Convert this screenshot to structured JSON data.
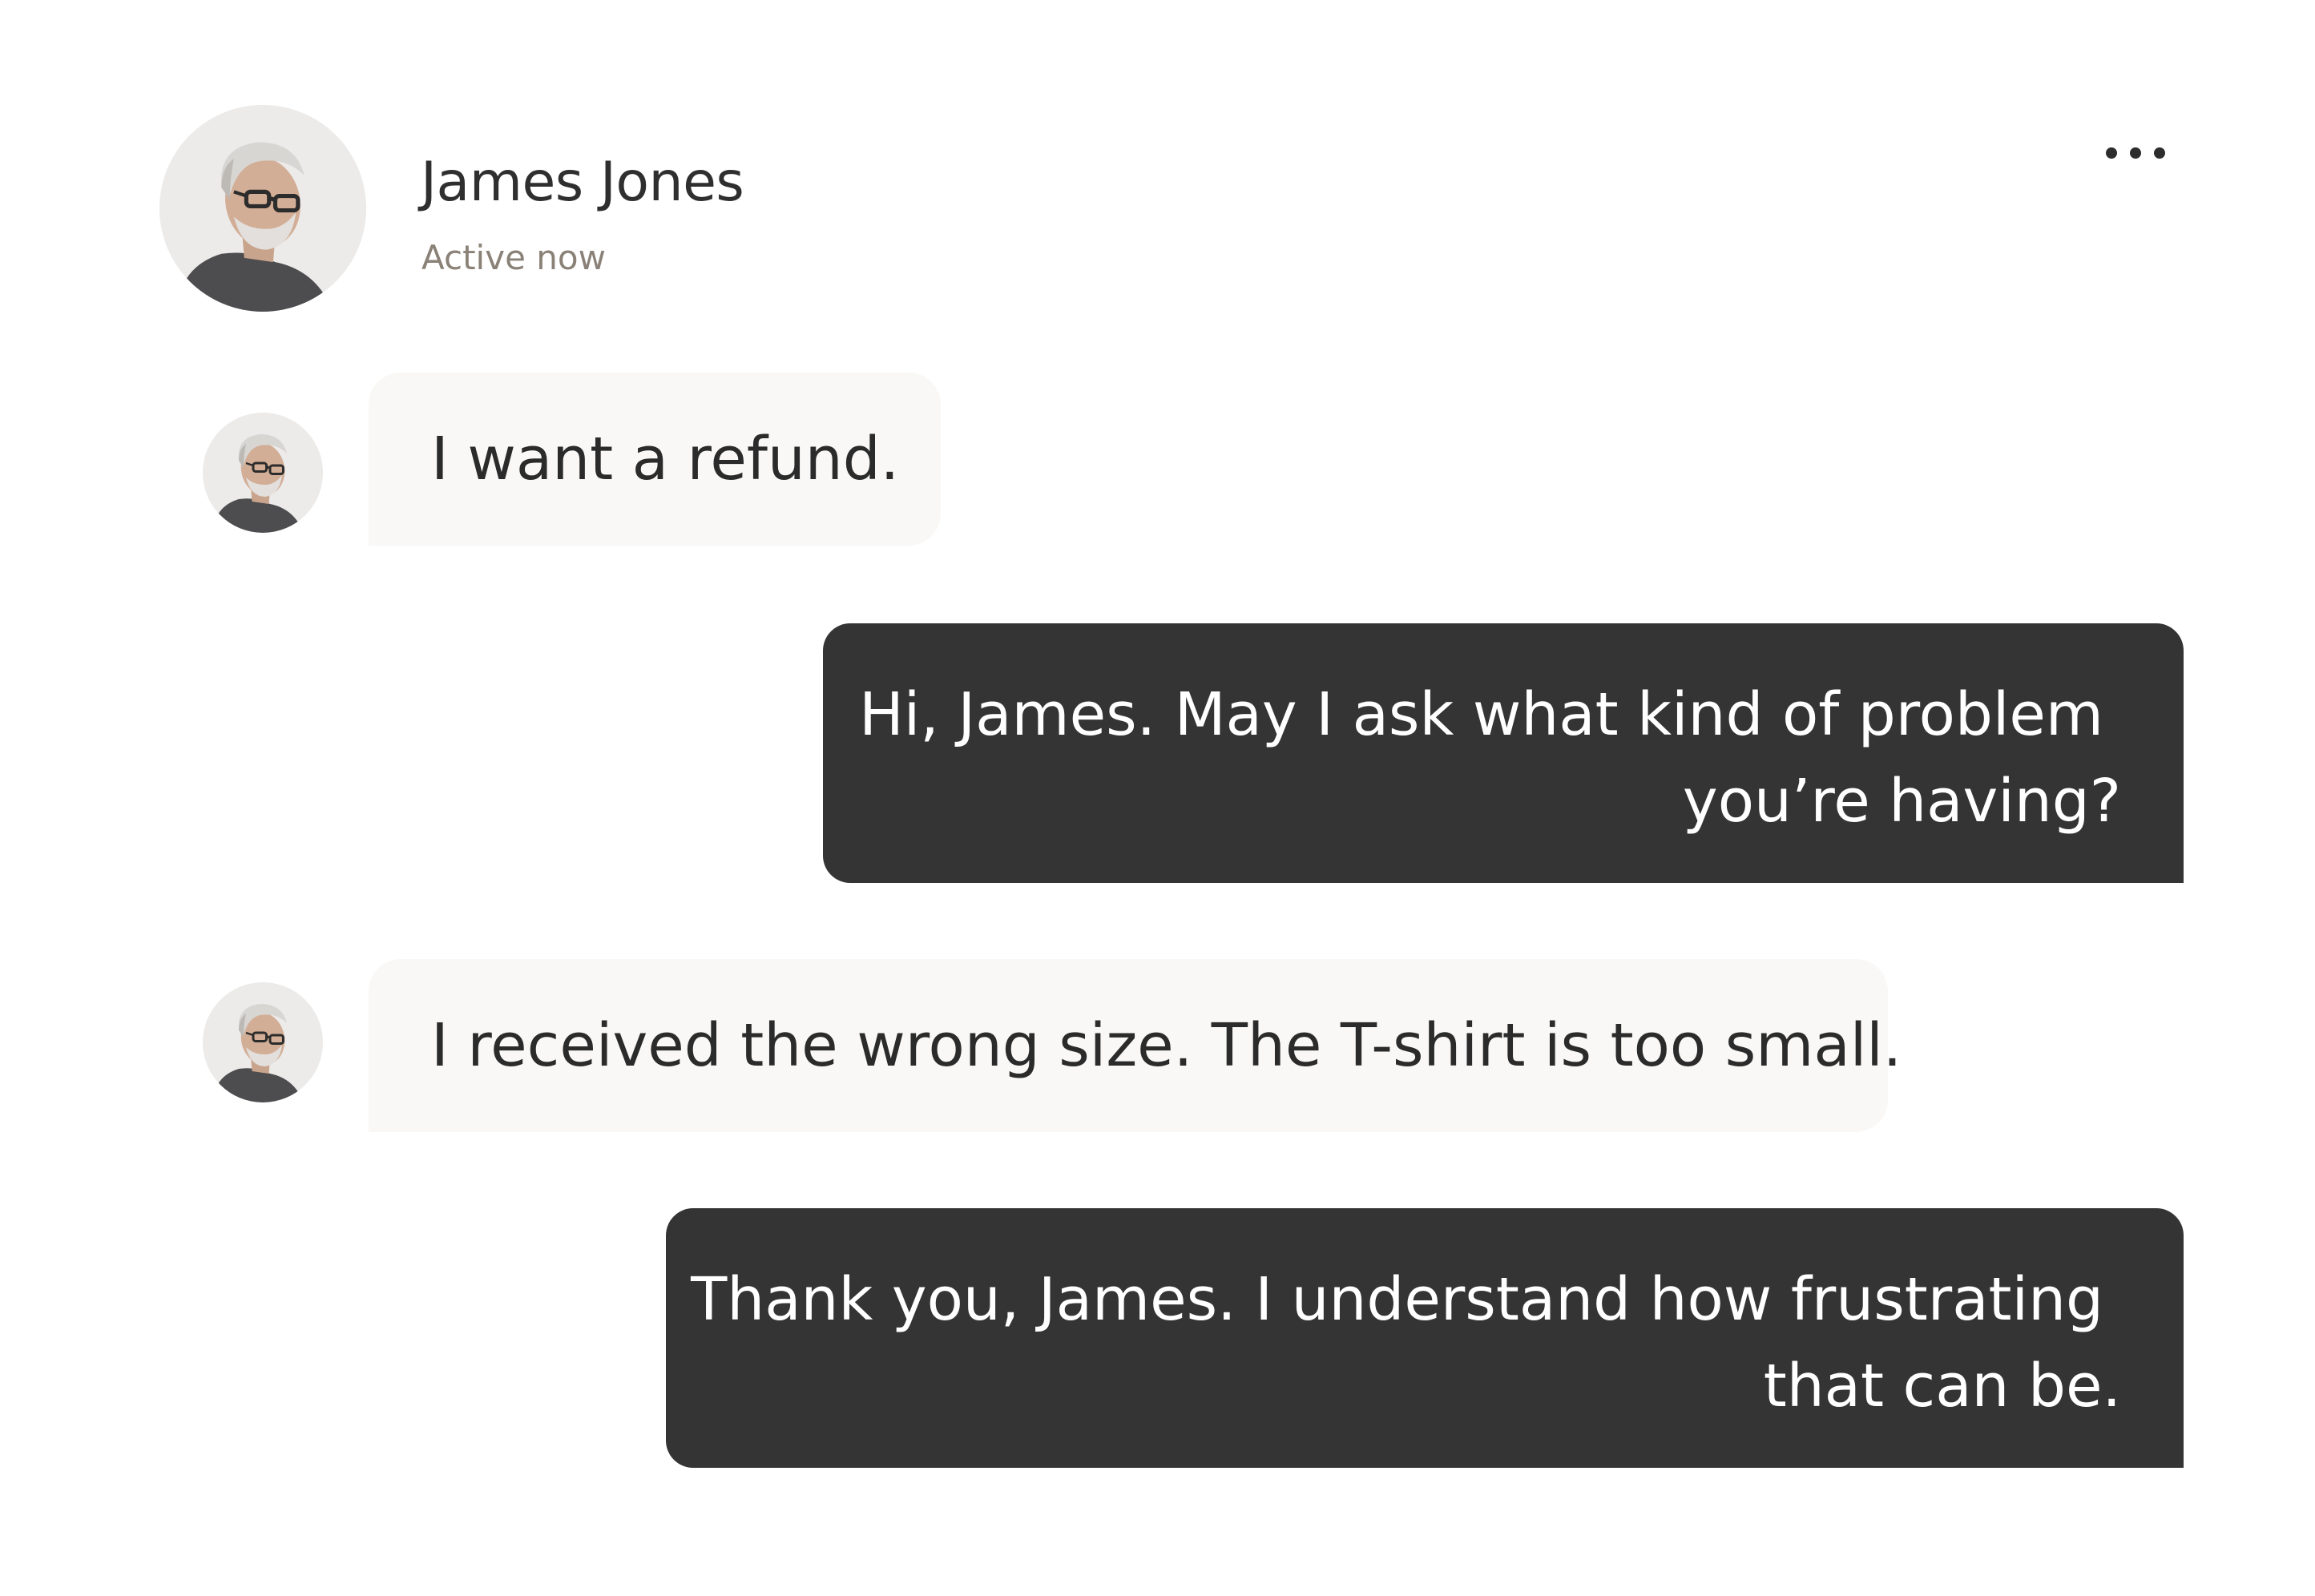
{
  "contact": {
    "name": "James Jones",
    "status": "Active now",
    "avatar_icon": "user-photo-avatar"
  },
  "header": {
    "more_icon": "more-horizontal-icon"
  },
  "colors": {
    "incoming_bubble": "#f9f8f6",
    "outgoing_bubble": "#343434",
    "status_text": "#8a8177"
  },
  "messages": [
    {
      "direction": "incoming",
      "lines": [
        "I want a refund."
      ]
    },
    {
      "direction": "outgoing",
      "lines": [
        "Hi, James. May I ask what kind of problem",
        "you’re having?"
      ]
    },
    {
      "direction": "incoming",
      "lines": [
        "I received the wrong size. The T-shirt is too small."
      ]
    },
    {
      "direction": "outgoing",
      "lines": [
        "Thank you, James. I understand how frustrating",
        "that can be."
      ]
    }
  ]
}
